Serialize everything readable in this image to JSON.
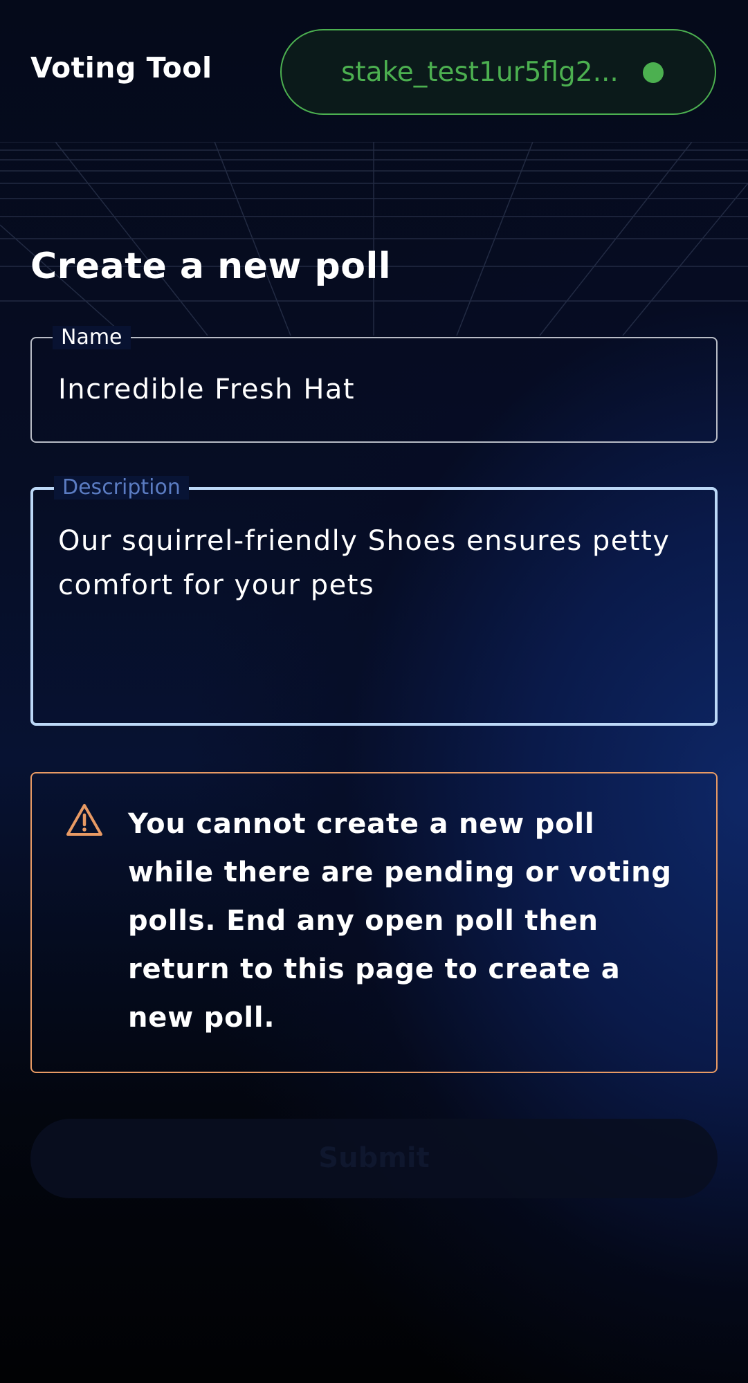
{
  "header": {
    "app_title": "Voting Tool",
    "wallet": {
      "address": "stake_test1ur5flg2...",
      "status_color": "#4cb050"
    }
  },
  "form": {
    "title": "Create a new poll",
    "name": {
      "label": "Name",
      "value": "Incredible Fresh Hat"
    },
    "description": {
      "label": "Description",
      "value": "Our squirrel-friendly Shoes ensures petty comfort for your pets"
    },
    "warning": {
      "icon": "warning-triangle-icon",
      "color": "#e89a64",
      "message": "You cannot create a new poll while there are pending or voting polls. End any open poll then return to this page to create a new poll."
    },
    "submit": {
      "label": "Submit",
      "disabled": true
    }
  },
  "theme": {
    "accent_green": "#4cb050",
    "focus_border": "#bcd8f7",
    "label_blue": "#5b7cc2"
  }
}
